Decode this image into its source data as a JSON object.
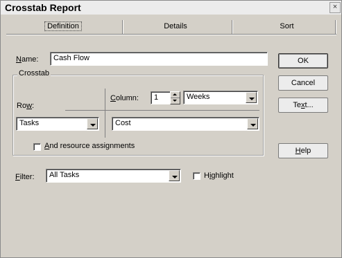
{
  "window": {
    "title": "Crosstab Report",
    "close_glyph": "×"
  },
  "tabs": [
    {
      "label": "Definition",
      "active": true
    },
    {
      "label": "Details",
      "active": false
    },
    {
      "label": "Sort",
      "active": false
    }
  ],
  "name": {
    "label": "Name:",
    "label_accel": "N",
    "label_rest": "ame:",
    "value": "Cash Flow"
  },
  "crosstab": {
    "group_label": "Crosstab",
    "column": {
      "label_accel": "C",
      "label_rest": "olumn:",
      "count": "1",
      "unit": "Weeks"
    },
    "row": {
      "label_pre": "Ro",
      "label_accel": "w",
      "label_post": ":",
      "value": "Tasks"
    },
    "field_value": "Cost",
    "assignments": {
      "label_accel": "A",
      "label_rest": "nd resource assignments",
      "checked": false
    }
  },
  "filter": {
    "label_accel": "F",
    "label_rest": "ilter:",
    "value": "All Tasks"
  },
  "highlight": {
    "label_pre": "H",
    "label_accel": "i",
    "label_post": "ghlight",
    "checked": false
  },
  "buttons": {
    "ok": "OK",
    "cancel": "Cancel",
    "text": {
      "pre": "Te",
      "accel": "x",
      "post": "t..."
    },
    "help": {
      "accel": "H",
      "rest": "elp"
    }
  }
}
